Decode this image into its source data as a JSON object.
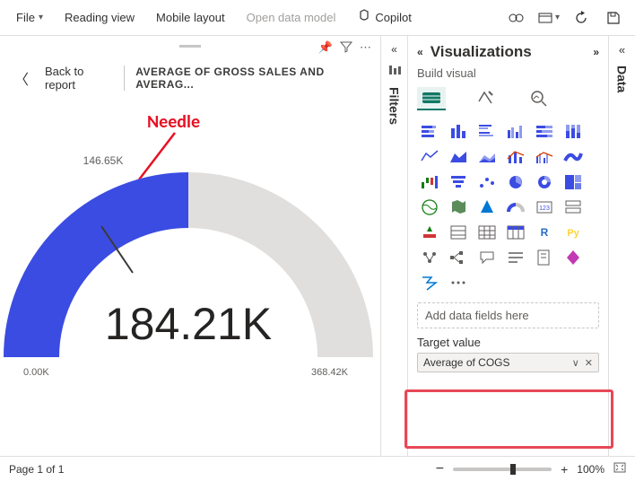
{
  "ribbon": {
    "file": "File",
    "reading_view": "Reading view",
    "mobile_layout": "Mobile layout",
    "open_data_model": "Open data model",
    "copilot": "Copilot"
  },
  "breadcrumb": {
    "back": "Back to report",
    "chart_title": "AVERAGE OF GROSS SALES AND AVERAG..."
  },
  "annotation": {
    "needle": "Needle"
  },
  "chart_data": {
    "type": "gauge",
    "value": 184.21,
    "value_label": "184.21K",
    "min": 0,
    "min_label": "0.00K",
    "max": 368.42,
    "max_label": "368.42K",
    "target": 146.65,
    "target_label": "146.65K",
    "unit": "K"
  },
  "panes": {
    "filters": "Filters",
    "data": "Data",
    "viz_title": "Visualizations",
    "build_visual": "Build visual"
  },
  "wells": {
    "add_fields": "Add data fields here",
    "target_label": "Target value",
    "target_field": "Average of COGS"
  },
  "status": {
    "page": "Page 1 of 1",
    "zoom": "100%"
  }
}
